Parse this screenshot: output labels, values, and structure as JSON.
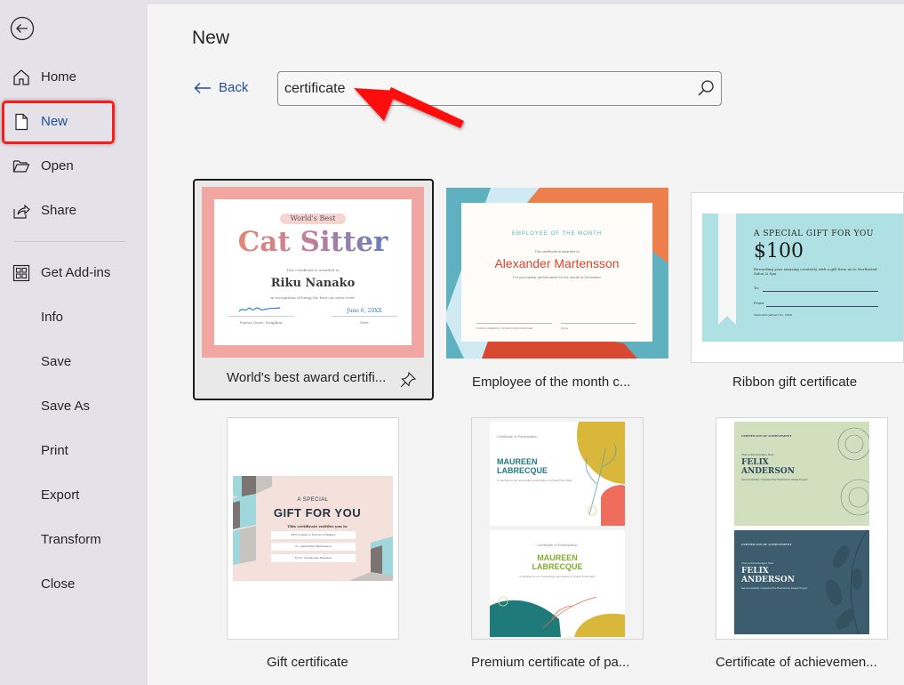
{
  "sidebar": {
    "back_icon": "back-arrow-circle-icon",
    "items": [
      {
        "label": "Home",
        "icon": "home-icon"
      },
      {
        "label": "New",
        "icon": "new-document-icon",
        "active": true
      },
      {
        "label": "Open",
        "icon": "folder-open-icon"
      },
      {
        "label": "Share",
        "icon": "share-icon"
      },
      {
        "label": "Get Add-ins",
        "icon": "add-ins-grid-icon"
      },
      {
        "label": "Info"
      },
      {
        "label": "Save"
      },
      {
        "label": "Save As"
      },
      {
        "label": "Print"
      },
      {
        "label": "Export"
      },
      {
        "label": "Transform"
      },
      {
        "label": "Close"
      }
    ]
  },
  "main": {
    "title": "New",
    "back_label": "Back",
    "search": {
      "value": "certificate",
      "icon": "search-icon"
    }
  },
  "templates": [
    {
      "caption": "World's best award certifi...",
      "selected": true,
      "pin_icon": "pin-icon",
      "preview": {
        "badge": "World's Best",
        "headline": "Cat Sitter",
        "awarded_to": "This certificate is awarded to",
        "name": "Riku Nanako",
        "reason": "in recognition of being the best cat sitter ever!",
        "signer": "Payton Davis, Neighbor",
        "date": "June 6, 20XX",
        "date_label": "Date"
      }
    },
    {
      "caption": "Employee of the month c...",
      "preview": {
        "heading": "EMPLOYEE OF THE MONTH",
        "awarded_to": "This certificate is awarded to",
        "name": "Alexander Martensson",
        "reason": "For your stellar performance for the month of December",
        "signer": "KIANA ANDERSON, OPERATIONS MANAGER",
        "date_label": "DATE"
      }
    },
    {
      "caption": "Ribbon gift certificate",
      "preview": {
        "heading": "A SPECIAL GIFT FOR YOU",
        "amount": "$100",
        "description": "Rewarding your amazing creativity with a gift from us to Northwind Salon & Spa",
        "to_label": "To:",
        "from_label": "From:",
        "valid": "Valid until January 01, 20XX"
      }
    },
    {
      "caption": "Gift certificate",
      "preview": {
        "kicker": "A SPECIAL",
        "heading": "GIFT FOR YOU",
        "entitles": "This certificate entitles you to",
        "line1": "Fifty dollars to Fourwood Bakery",
        "line2": "To: Alexandria Martensson",
        "line3": "From: Christophe Beaulieu"
      }
    },
    {
      "caption": "Premium certificate of pa...",
      "preview": {
        "heading": "Certificate of Participation",
        "name_line1": "MAUREEN",
        "name_line2": "LABRECQUE",
        "reason": "is thanked for her outstanding participation in Virtual Trivia Night"
      }
    },
    {
      "caption": "Certificate of achievemen...",
      "preview": {
        "heading": "CERTIFICATE OF ACHIEVEMENT",
        "intro": "This acknowledges that",
        "name_line1": "FELIX",
        "name_line2": "ANDERSON",
        "reason": "has successfully completed the Restoration Design Project"
      }
    }
  ],
  "colors": {
    "accent_blue": "#1f4e9b",
    "annotation_red": "#ff1a1a",
    "sidebar_bg": "#e4e2e8",
    "main_bg": "#f4f4f4"
  }
}
